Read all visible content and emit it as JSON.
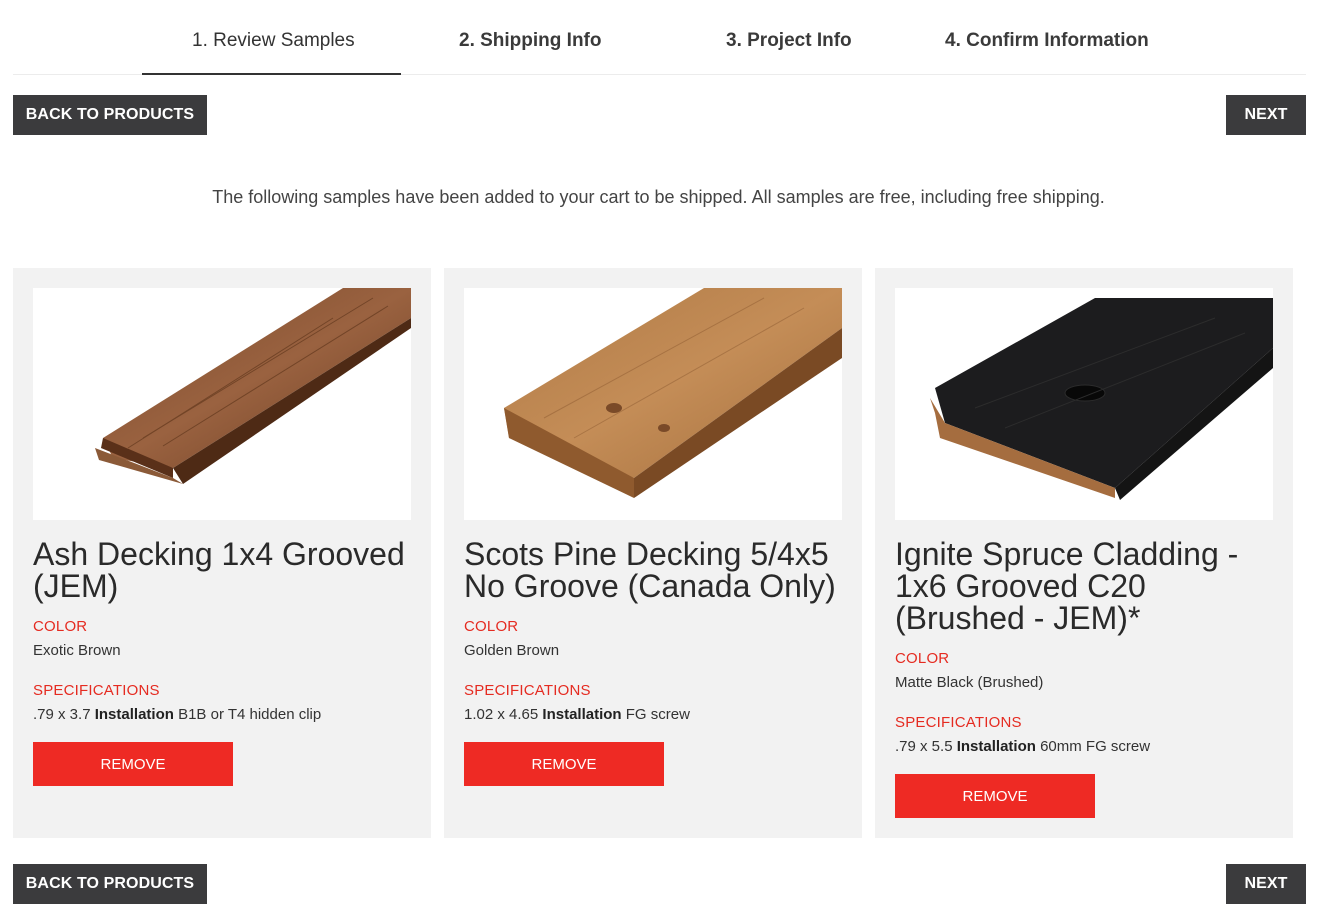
{
  "steps": [
    {
      "label": "1. Review Samples"
    },
    {
      "label": "2. Shipping Info"
    },
    {
      "label": "3. Project Info"
    },
    {
      "label": "4. Confirm Information"
    }
  ],
  "nav": {
    "back_label": "BACK TO PRODUCTS",
    "next_label": "NEXT"
  },
  "intro_text": "The following samples have been added to your cart to be shipped. All samples are free, including free shipping.",
  "labels": {
    "color": "COLOR",
    "specifications": "SPECIFICATIONS",
    "installation": "Installation",
    "remove": "REMOVE"
  },
  "products": [
    {
      "title": "Ash Decking 1x4 Grooved (JEM)",
      "color": "Exotic Brown",
      "dims": ".79 x 3.7",
      "install": "B1B or T4 hidden clip",
      "image": "ash-decking-board"
    },
    {
      "title": "Scots Pine Decking 5/4x5 No Groove (Canada Only)",
      "color": "Golden Brown",
      "dims": "1.02 x 4.65",
      "install": "FG screw",
      "image": "scots-pine-board"
    },
    {
      "title": "Ignite Spruce Cladding - 1x6 Grooved C20 (Brushed - JEM)*",
      "color": "Matte Black (Brushed)",
      "dims": ".79 x 5.5",
      "install": "60mm FG screw",
      "image": "black-spruce-board"
    }
  ],
  "colors": {
    "accent_red": "#ee2a24",
    "dark_button": "#3b3b3d",
    "card_bg": "#f2f2f2"
  }
}
